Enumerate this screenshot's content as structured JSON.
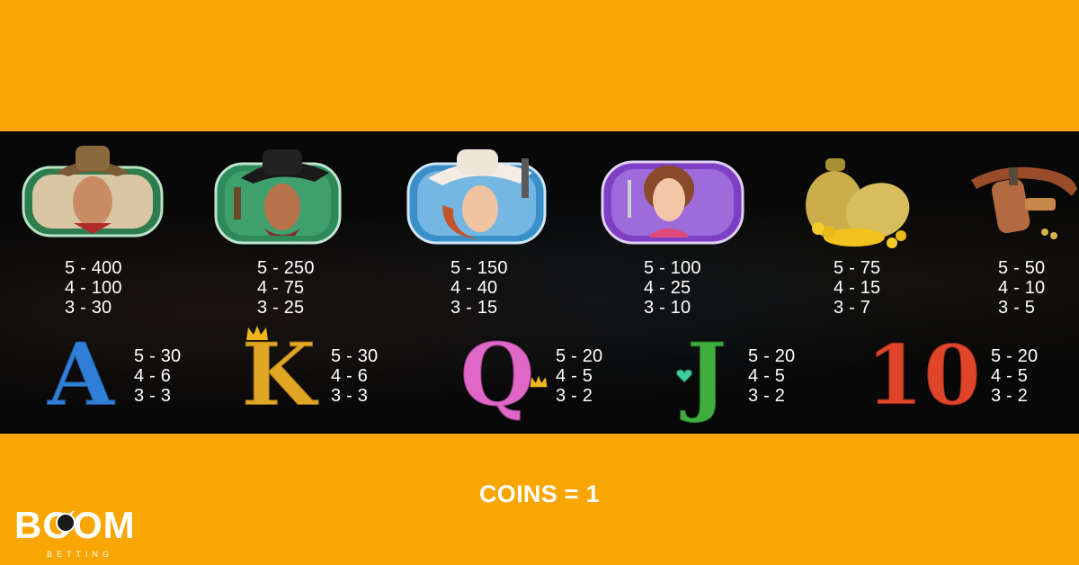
{
  "paytable": {
    "premium": [
      {
        "icon": "sheriff-cowboy-icon",
        "color": "#2e7d4f",
        "payouts": [
          "5 - 400",
          "4 - 100",
          "3 - 30"
        ]
      },
      {
        "icon": "outlaw-cowboy-icon",
        "color": "#2e8a5a",
        "payouts": [
          "5 - 250",
          "4 - 75",
          "3 - 25"
        ]
      },
      {
        "icon": "cowgirl-icon",
        "color": "#3a8fc8",
        "payouts": [
          "5 - 150",
          "4 - 40",
          "3 - 15"
        ]
      },
      {
        "icon": "saloon-girl-icon",
        "color": "#7d3fc4",
        "payouts": [
          "5 - 100",
          "4 - 25",
          "3 - 10"
        ]
      },
      {
        "icon": "gold-money-bags-icon",
        "color": "#d8b640",
        "payouts": [
          "5 - 75",
          "4 - 15",
          "3 - 7"
        ]
      },
      {
        "icon": "gun-belt-holster-icon",
        "color": "#a8552e",
        "payouts": [
          "5 - 50",
          "4 - 10",
          "3 - 5"
        ]
      }
    ],
    "low": [
      {
        "label": "A",
        "icon": "letter-a-icon",
        "color": "#2f7fd6",
        "payouts": [
          "5 - 30",
          "4 - 6",
          "3 - 3"
        ]
      },
      {
        "label": "K",
        "icon": "letter-k-icon",
        "color": "#e0a624",
        "payouts": [
          "5 - 30",
          "4 - 6",
          "3 - 3"
        ]
      },
      {
        "label": "Q",
        "icon": "letter-q-icon",
        "color": "#e067c8",
        "payouts": [
          "5 - 20",
          "4 - 5",
          "3 - 2"
        ]
      },
      {
        "label": "J",
        "icon": "letter-j-icon",
        "color": "#3fae3f",
        "payouts": [
          "5 - 20",
          "4 - 5",
          "3 - 2"
        ]
      },
      {
        "label": "10",
        "icon": "number-10-icon",
        "color": "#e0452a",
        "payouts": [
          "5 - 20",
          "4 - 5",
          "3 - 2"
        ]
      }
    ]
  },
  "footer": {
    "coins_label": "COINS = 1"
  },
  "brand": {
    "logo_text": "BOOM",
    "logo_sub": "BETTING"
  }
}
